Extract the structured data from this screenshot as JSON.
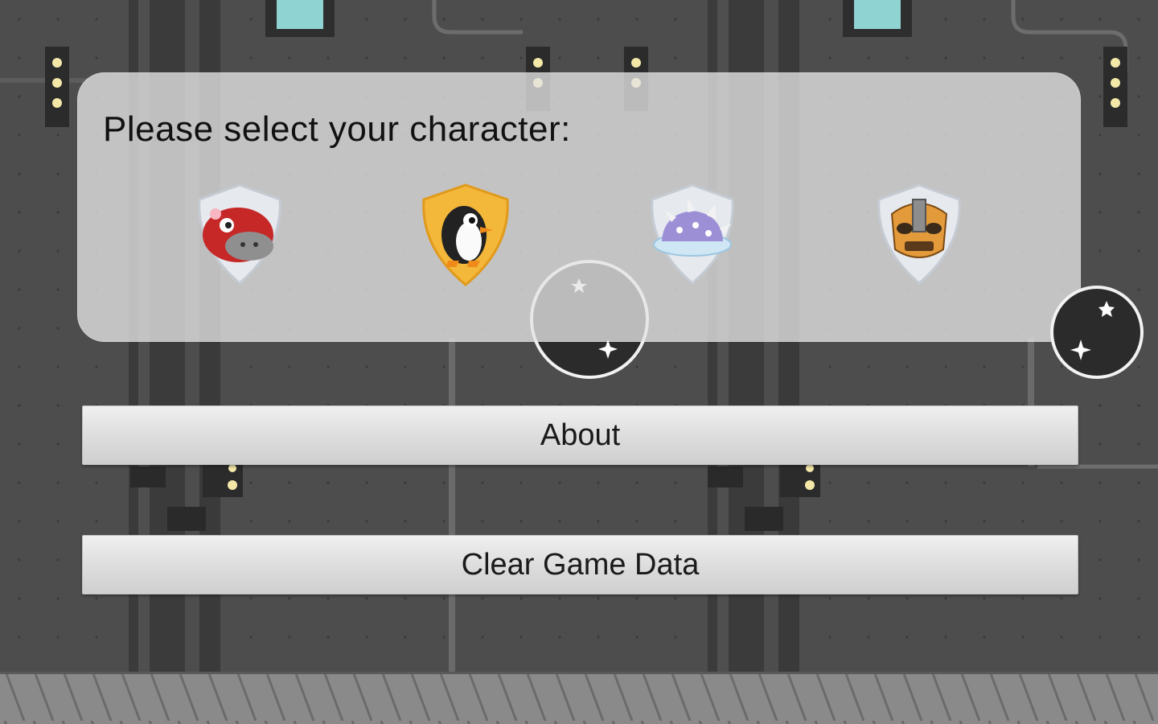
{
  "panel": {
    "title": "Please select your character:"
  },
  "characters": [
    {
      "icon": "red-hippo-icon",
      "shield": "silver",
      "selected": false
    },
    {
      "icon": "penguin-icon",
      "shield": "gold",
      "selected": true
    },
    {
      "icon": "spiky-shell-icon",
      "shield": "silver",
      "selected": false
    },
    {
      "icon": "armored-mask-icon",
      "shield": "silver",
      "selected": false
    }
  ],
  "buttons": {
    "about_label": "About",
    "clear_label": "Clear Game Data"
  },
  "colors": {
    "gold_shield": "#f3b73a",
    "silver_shield": "#dfe3e8",
    "background": "#4a4a4a"
  }
}
